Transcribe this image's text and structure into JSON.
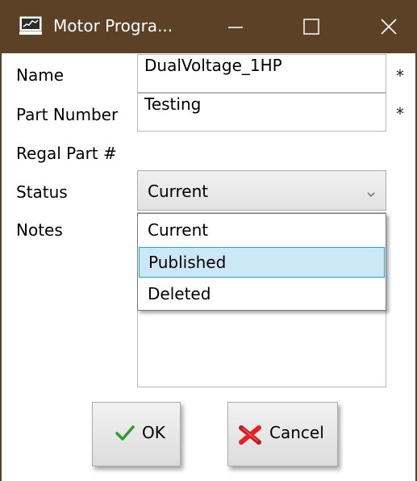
{
  "window": {
    "title": "Motor Progra...",
    "icon": "app-icon",
    "controls": {
      "minimize": "minimize-icon",
      "maximize": "maximize-icon",
      "close": "close-icon"
    },
    "titlebar_color": "#5c4126"
  },
  "form": {
    "name": {
      "label": "Name",
      "value": "DualVoltage_1HP",
      "required_mark": "*"
    },
    "part_number": {
      "label": "Part Number",
      "value": "Testing",
      "required_mark": "*"
    },
    "regal_part": {
      "label": "Regal Part #"
    },
    "status": {
      "label": "Status",
      "value": "Current",
      "options": [
        "Current",
        "Published",
        "Deleted"
      ],
      "highlighted_option": "Published"
    },
    "notes": {
      "label": "Notes",
      "value": ""
    }
  },
  "buttons": {
    "ok": {
      "label": "OK",
      "icon": "check-icon"
    },
    "cancel": {
      "label": "Cancel",
      "icon": "cancel-x-icon"
    }
  },
  "colors": {
    "highlight_background": "#cce8f6",
    "highlight_border": "#26a0da",
    "ok_icon": "#2f9b2f",
    "cancel_icon": "#d42020"
  }
}
